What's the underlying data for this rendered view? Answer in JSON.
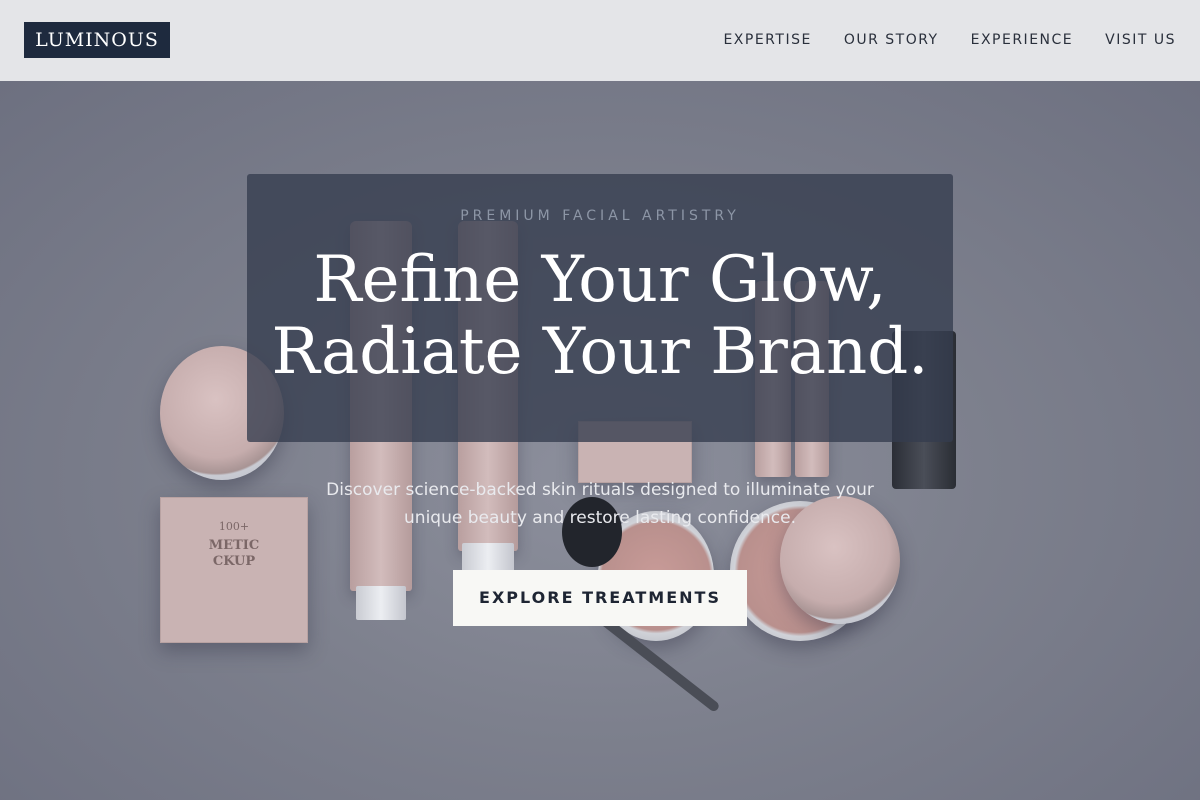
{
  "header": {
    "logo": "LUMINOUS",
    "nav": [
      "EXPERTISE",
      "OUR STORY",
      "EXPERIENCE",
      "VISIT US"
    ]
  },
  "hero": {
    "eyebrow": "PREMIUM FACIAL ARTISTRY",
    "headline_line1": "Refine Your Glow,",
    "headline_line2": "Radiate Your Brand.",
    "subtext": "Discover science-backed skin rituals designed to illuminate your unique beauty and restore lasting confidence.",
    "cta_label": "EXPLORE TREATMENTS"
  },
  "colors": {
    "header_bg": "#e4e5e8",
    "logo_bg": "#1e2a3e",
    "card_bg": "#343c4e",
    "cta_bg": "#f8f8f5",
    "cta_text": "#1e2533"
  }
}
